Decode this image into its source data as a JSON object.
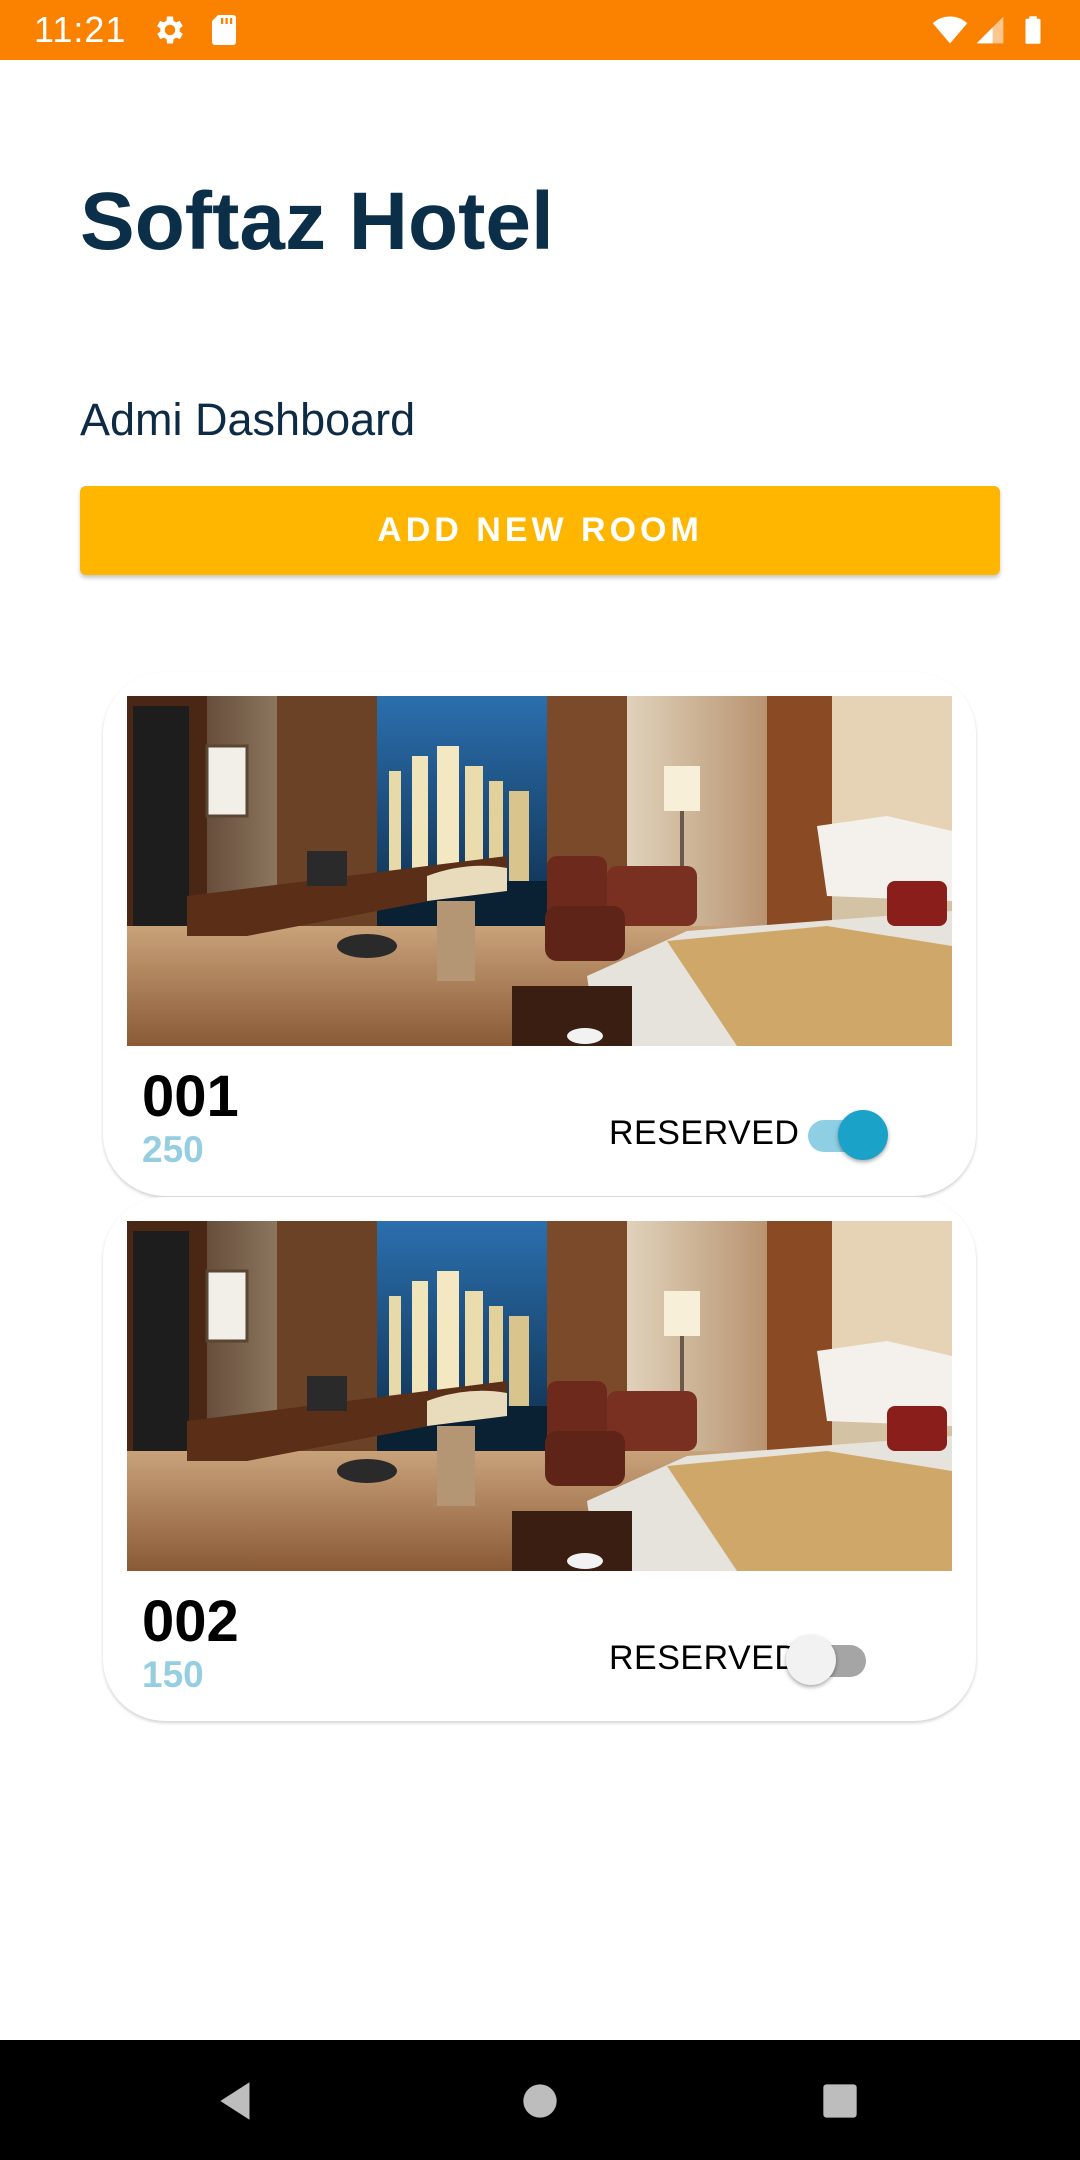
{
  "status_bar": {
    "time": "11:21",
    "background": "#fb8200",
    "icons": [
      "settings-icon",
      "sd-card-icon",
      "wifi-icon",
      "signal-icon",
      "battery-icon"
    ]
  },
  "header": {
    "title": "Softaz Hotel",
    "subtitle": "Admi Dashboard"
  },
  "actions": {
    "add_room_label": "ADD NEW ROOM"
  },
  "rooms": [
    {
      "number": "001",
      "price": "250",
      "reserved_label": "RESERVED",
      "reserved": true
    },
    {
      "number": "002",
      "price": "150",
      "reserved_label": "RESERVED",
      "reserved": false
    }
  ],
  "colors": {
    "accent_button": "#ffb600",
    "title": "#0b2e49",
    "price": "#95cde1",
    "switch_on": "#1aa2c9"
  },
  "nav_bar": {
    "icons": [
      "back-icon",
      "home-icon",
      "recents-icon"
    ]
  }
}
